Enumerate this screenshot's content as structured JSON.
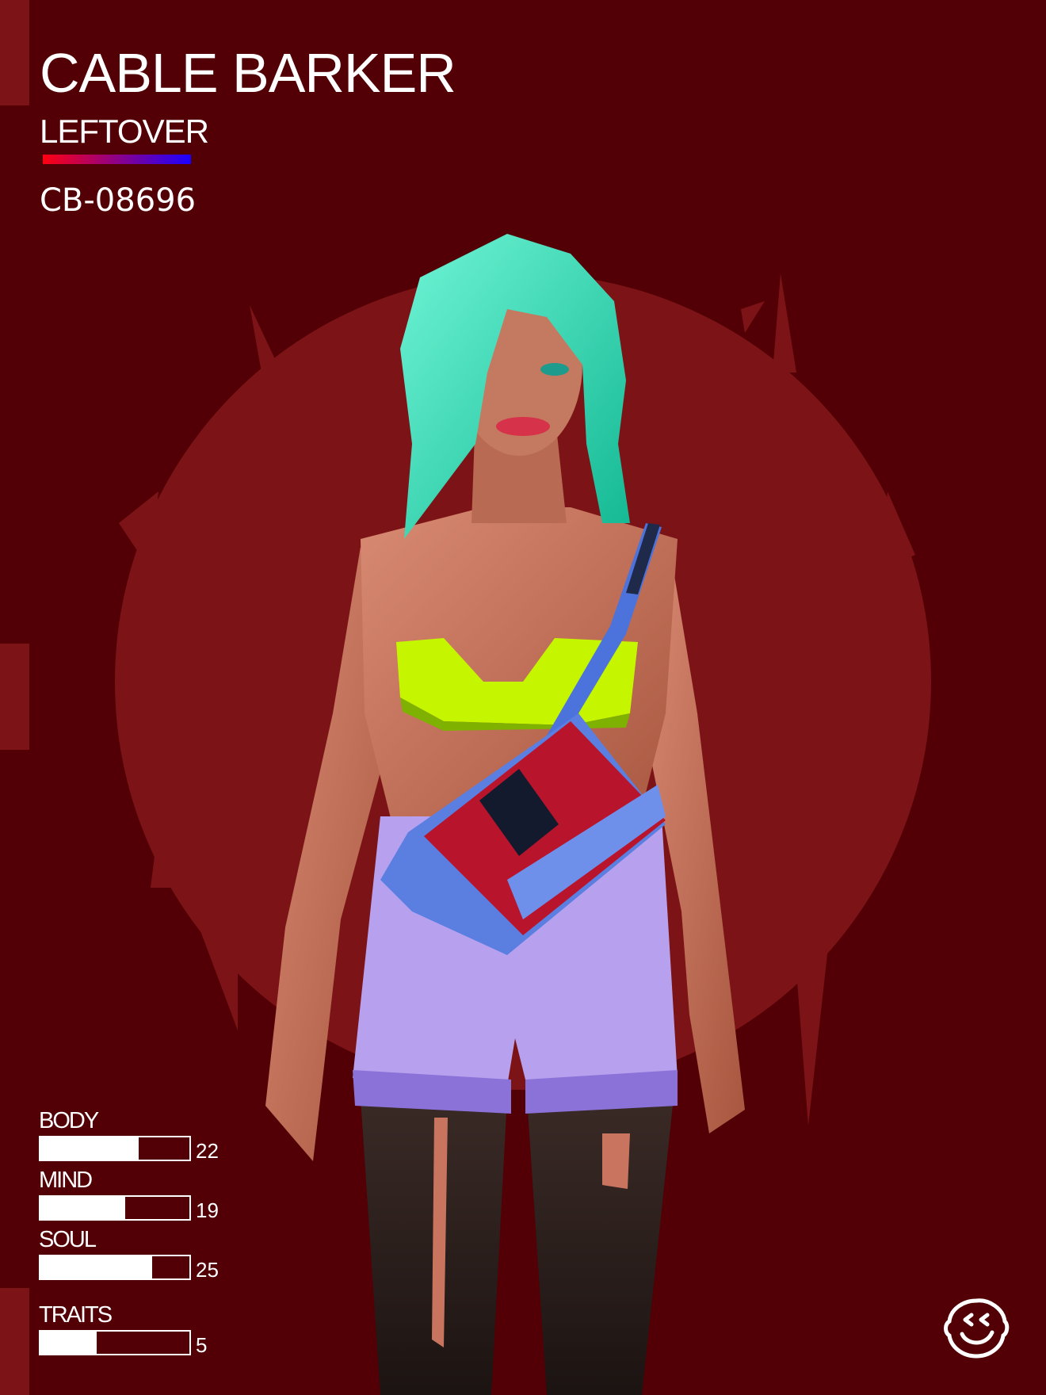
{
  "card": {
    "name": "CABLE BARKER",
    "class": "LEFTOVER",
    "id": "CB-08696",
    "colors": {
      "background": "#520005",
      "accent_panel": "#7c1417",
      "gradient_start": "#ff0010",
      "gradient_end": "#1b00ff",
      "text": "#ffffff"
    }
  },
  "illustration": {
    "subject": "character-portrait",
    "hair_color": "#4de8c4",
    "top_color": "#c6f500",
    "shorts_color": "#b7a1ee",
    "bag_colors": [
      "#b8142c",
      "#5a7fe0"
    ]
  },
  "stats": [
    {
      "label": "BODY",
      "value": "22",
      "fraction": 0.66
    },
    {
      "label": "MIND",
      "value": "19",
      "fraction": 0.57
    },
    {
      "label": "SOUL",
      "value": "25",
      "fraction": 0.75
    },
    {
      "label": "TRAITS",
      "value": "5",
      "fraction": 0.38
    }
  ],
  "logo": {
    "icon": "smiley-face-badge-icon"
  }
}
